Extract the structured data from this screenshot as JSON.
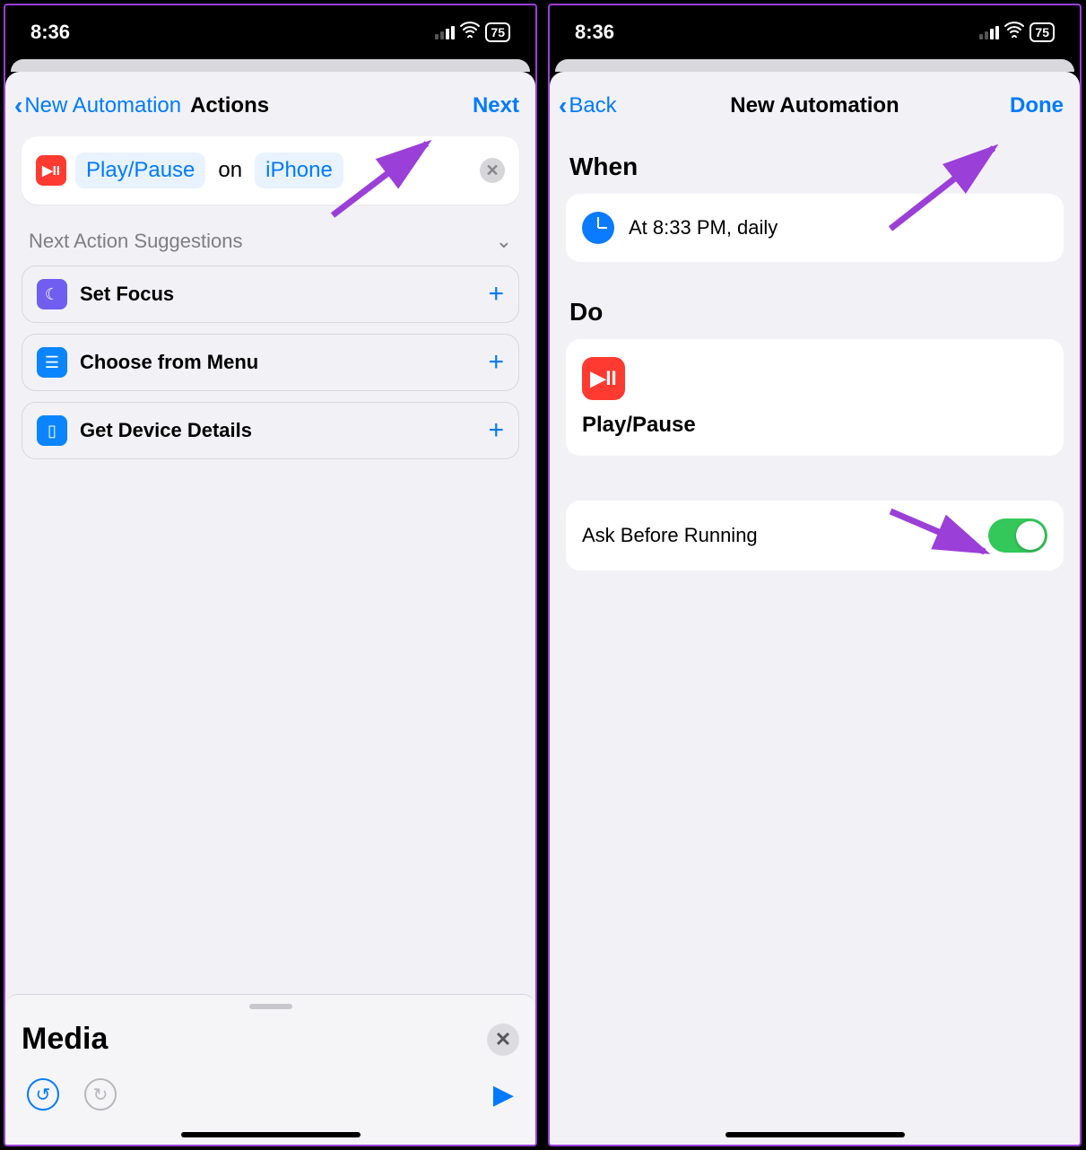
{
  "status": {
    "time": "8:36",
    "battery": "75"
  },
  "left": {
    "nav": {
      "back": "New Automation",
      "title": "Actions",
      "next": "Next"
    },
    "action": {
      "token1": "Play/Pause",
      "on": "on",
      "token2": "iPhone"
    },
    "suggestions_header": "Next Action Suggestions",
    "suggestions": [
      {
        "label": "Set Focus"
      },
      {
        "label": "Choose from Menu"
      },
      {
        "label": "Get Device Details"
      }
    ],
    "drawer": {
      "title": "Media"
    }
  },
  "right": {
    "nav": {
      "back": "Back",
      "title": "New Automation",
      "done": "Done"
    },
    "when_header": "When",
    "when_text": "At 8:33 PM, daily",
    "do_header": "Do",
    "do_label": "Play/Pause",
    "ask_label": "Ask Before Running"
  }
}
